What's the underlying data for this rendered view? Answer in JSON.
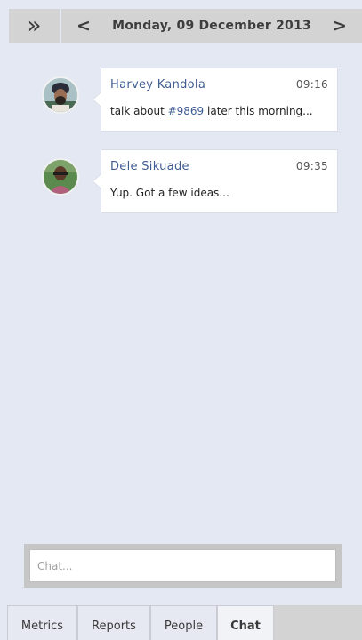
{
  "header": {
    "collapse_icon": "double-chevron-right-icon",
    "collapse_glyph": "»",
    "prev_glyph": "<",
    "next_glyph": ">",
    "date": "Monday, 09 December 2013"
  },
  "messages": [
    {
      "author": "Harvey Kandola",
      "time": "09:16",
      "text_before": "talk about ",
      "link": "#9869 ",
      "text_after": "later this morning...",
      "avatar_icon": "user-avatar"
    },
    {
      "author": "Dele Sikuade",
      "time": "09:35",
      "text": "Yup. Got a few ideas...",
      "avatar_icon": "user-avatar"
    }
  ],
  "chat": {
    "placeholder": "Chat..."
  },
  "tabs": [
    {
      "label": "Metrics",
      "active": false
    },
    {
      "label": "Reports",
      "active": false
    },
    {
      "label": "People",
      "active": false
    },
    {
      "label": "Chat",
      "active": true
    }
  ],
  "colors": {
    "background": "#e4e8f3",
    "bar": "#d3d3d3",
    "link": "#3e5c92"
  }
}
